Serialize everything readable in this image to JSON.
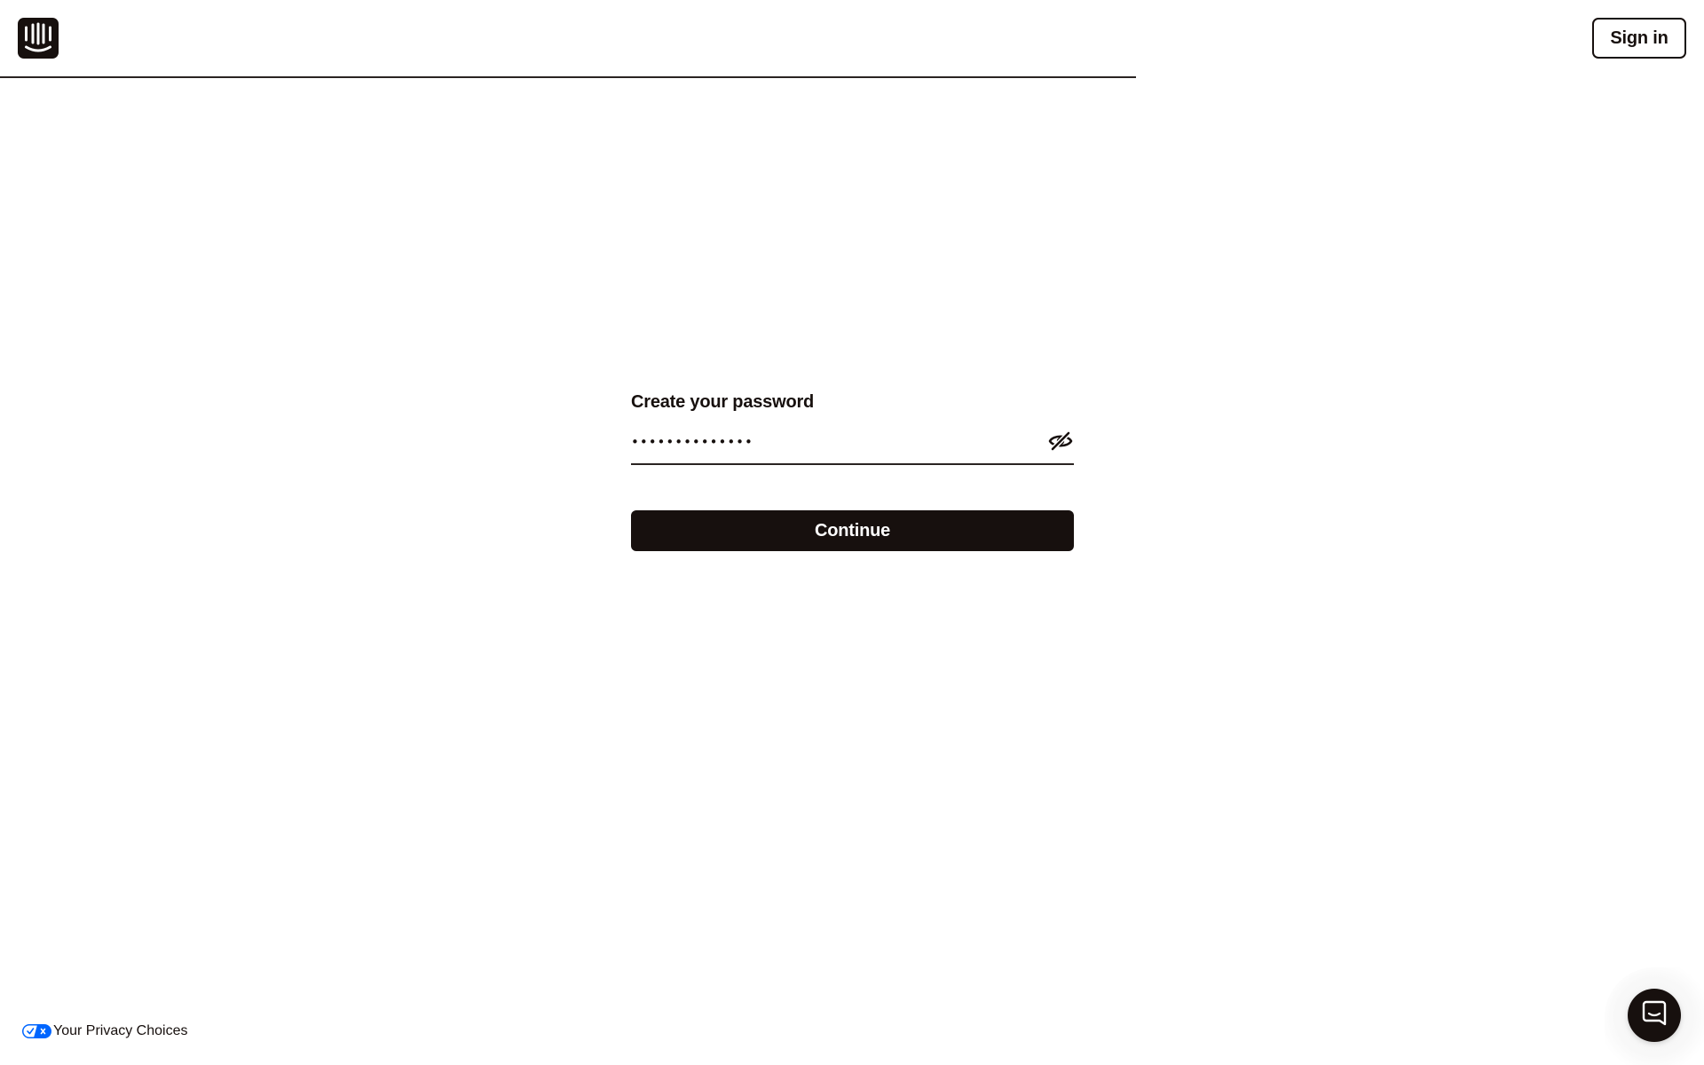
{
  "brand": {
    "logo_icon": "intercom-logo-icon",
    "color": "#17100e"
  },
  "header": {
    "signin_label": "Sign in"
  },
  "form": {
    "password_label": "Create your password",
    "password_value": "••••••••••••••",
    "visibility_icon": "eye-slash-icon",
    "continue_label": "Continue"
  },
  "footer": {
    "privacy_label": "Your Privacy Choices",
    "privacy_icon": "privacy-toggle-icon",
    "privacy_icon_color": "#0066ff"
  },
  "messenger": {
    "launcher_icon": "chat-bubble-icon"
  }
}
